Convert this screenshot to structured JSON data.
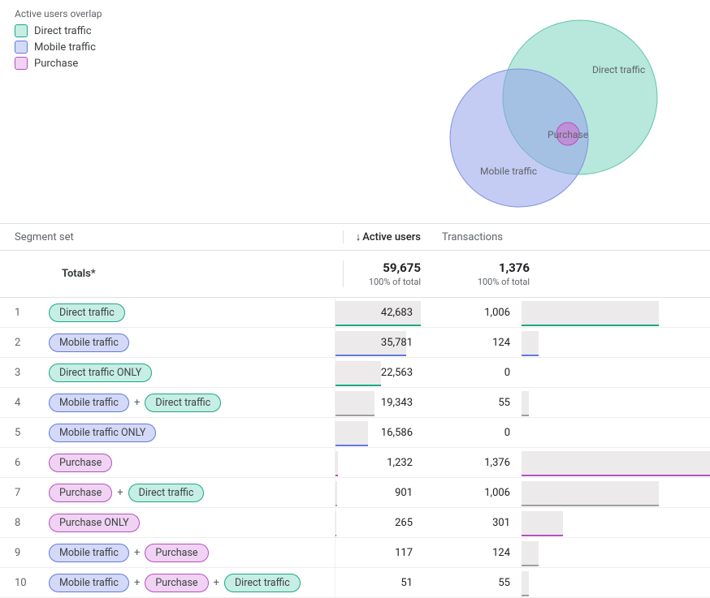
{
  "legend": {
    "title": "Active users overlap",
    "items": [
      {
        "label": "Direct traffic",
        "cls": "sw-direct"
      },
      {
        "label": "Mobile traffic",
        "cls": "sw-mobile"
      },
      {
        "label": "Purchase",
        "cls": "sw-purchase"
      }
    ]
  },
  "venn": {
    "direct": "Direct traffic",
    "mobile": "Mobile traffic",
    "purchase": "Purchase"
  },
  "headers": {
    "segment": "Segment set",
    "active_users": "Active users",
    "transactions": "Transactions"
  },
  "totals": {
    "label": "Totals*",
    "active_users": "59,675",
    "au_sub": "100% of total",
    "transactions": "1,376",
    "tx_sub": "100% of total"
  },
  "rows": [
    {
      "n": "1",
      "chips": [
        {
          "label": "Direct traffic",
          "cls": "chip-direct"
        }
      ],
      "au": "42,683",
      "au_bar": 96,
      "au_u": "u-direct",
      "au_uw": 96,
      "tx": "1,006",
      "tx_bar": 73,
      "tx_u": "u-direct",
      "tx_uw": 73
    },
    {
      "n": "2",
      "chips": [
        {
          "label": "Mobile traffic",
          "cls": "chip-mobile"
        }
      ],
      "au": "35,781",
      "au_bar": 80,
      "au_u": "u-mobile",
      "au_uw": 80,
      "tx": "124",
      "tx_bar": 9,
      "tx_u": "u-mobile",
      "tx_uw": 9
    },
    {
      "n": "3",
      "chips": [
        {
          "label": "Direct traffic ONLY",
          "cls": "chip-direct"
        }
      ],
      "au": "22,563",
      "au_bar": 51,
      "au_u": "u-direct",
      "au_uw": 51,
      "tx": "0",
      "tx_bar": 0,
      "tx_u": "u-grey",
      "tx_uw": 0
    },
    {
      "n": "4",
      "chips": [
        {
          "label": "Mobile traffic",
          "cls": "chip-mobile"
        },
        {
          "label": "Direct traffic",
          "cls": "chip-direct"
        }
      ],
      "au": "19,343",
      "au_bar": 44,
      "au_u": "u-grey",
      "au_uw": 44,
      "tx": "55",
      "tx_bar": 4,
      "tx_u": "u-grey",
      "tx_uw": 4
    },
    {
      "n": "5",
      "chips": [
        {
          "label": "Mobile traffic ONLY",
          "cls": "chip-mobile"
        }
      ],
      "au": "16,586",
      "au_bar": 37,
      "au_u": "u-mobile",
      "au_uw": 37,
      "tx": "0",
      "tx_bar": 0,
      "tx_u": "u-grey",
      "tx_uw": 0
    },
    {
      "n": "6",
      "chips": [
        {
          "label": "Purchase",
          "cls": "chip-purchase"
        }
      ],
      "au": "1,232",
      "au_bar": 3,
      "au_u": "u-purchase",
      "au_uw": 3,
      "tx": "1,376",
      "tx_bar": 100,
      "tx_u": "u-purchase",
      "tx_uw": 100
    },
    {
      "n": "7",
      "chips": [
        {
          "label": "Purchase",
          "cls": "chip-purchase"
        },
        {
          "label": "Direct traffic",
          "cls": "chip-direct"
        }
      ],
      "au": "901",
      "au_bar": 2,
      "au_u": "u-grey",
      "au_uw": 2,
      "tx": "1,006",
      "tx_bar": 73,
      "tx_u": "u-grey",
      "tx_uw": 73
    },
    {
      "n": "8",
      "chips": [
        {
          "label": "Purchase ONLY",
          "cls": "chip-purchase"
        }
      ],
      "au": "265",
      "au_bar": 1,
      "au_u": "u-purchase",
      "au_uw": 1,
      "tx": "301",
      "tx_bar": 22,
      "tx_u": "u-purchase",
      "tx_uw": 22
    },
    {
      "n": "9",
      "chips": [
        {
          "label": "Mobile traffic",
          "cls": "chip-mobile"
        },
        {
          "label": "Purchase",
          "cls": "chip-purchase"
        }
      ],
      "au": "117",
      "au_bar": 0,
      "au_u": "u-grey",
      "au_uw": 0,
      "tx": "124",
      "tx_bar": 9,
      "tx_u": "u-grey",
      "tx_uw": 9
    },
    {
      "n": "10",
      "chips": [
        {
          "label": "Mobile traffic",
          "cls": "chip-mobile"
        },
        {
          "label": "Purchase",
          "cls": "chip-purchase"
        },
        {
          "label": "Direct traffic",
          "cls": "chip-direct"
        }
      ],
      "au": "51",
      "au_bar": 0,
      "au_u": "u-grey",
      "au_uw": 0,
      "tx": "55",
      "tx_bar": 4,
      "tx_u": "u-grey",
      "tx_uw": 4
    }
  ],
  "chart_data": {
    "type": "venn-with-table",
    "sets": [
      {
        "name": "Direct traffic",
        "active_users": 42683,
        "transactions": 1006
      },
      {
        "name": "Mobile traffic",
        "active_users": 35781,
        "transactions": 124
      },
      {
        "name": "Purchase",
        "active_users": 1232,
        "transactions": 1376
      }
    ],
    "segments": [
      {
        "set": [
          "Direct traffic"
        ],
        "only": false,
        "active_users": 42683,
        "transactions": 1006
      },
      {
        "set": [
          "Mobile traffic"
        ],
        "only": false,
        "active_users": 35781,
        "transactions": 124
      },
      {
        "set": [
          "Direct traffic"
        ],
        "only": true,
        "active_users": 22563,
        "transactions": 0
      },
      {
        "set": [
          "Mobile traffic",
          "Direct traffic"
        ],
        "only": false,
        "active_users": 19343,
        "transactions": 55
      },
      {
        "set": [
          "Mobile traffic"
        ],
        "only": true,
        "active_users": 16586,
        "transactions": 0
      },
      {
        "set": [
          "Purchase"
        ],
        "only": false,
        "active_users": 1232,
        "transactions": 1376
      },
      {
        "set": [
          "Purchase",
          "Direct traffic"
        ],
        "only": false,
        "active_users": 901,
        "transactions": 1006
      },
      {
        "set": [
          "Purchase"
        ],
        "only": true,
        "active_users": 265,
        "transactions": 301
      },
      {
        "set": [
          "Mobile traffic",
          "Purchase"
        ],
        "only": false,
        "active_users": 117,
        "transactions": 124
      },
      {
        "set": [
          "Mobile traffic",
          "Purchase",
          "Direct traffic"
        ],
        "only": false,
        "active_users": 51,
        "transactions": 55
      }
    ],
    "totals": {
      "active_users": 59675,
      "transactions": 1376
    }
  }
}
